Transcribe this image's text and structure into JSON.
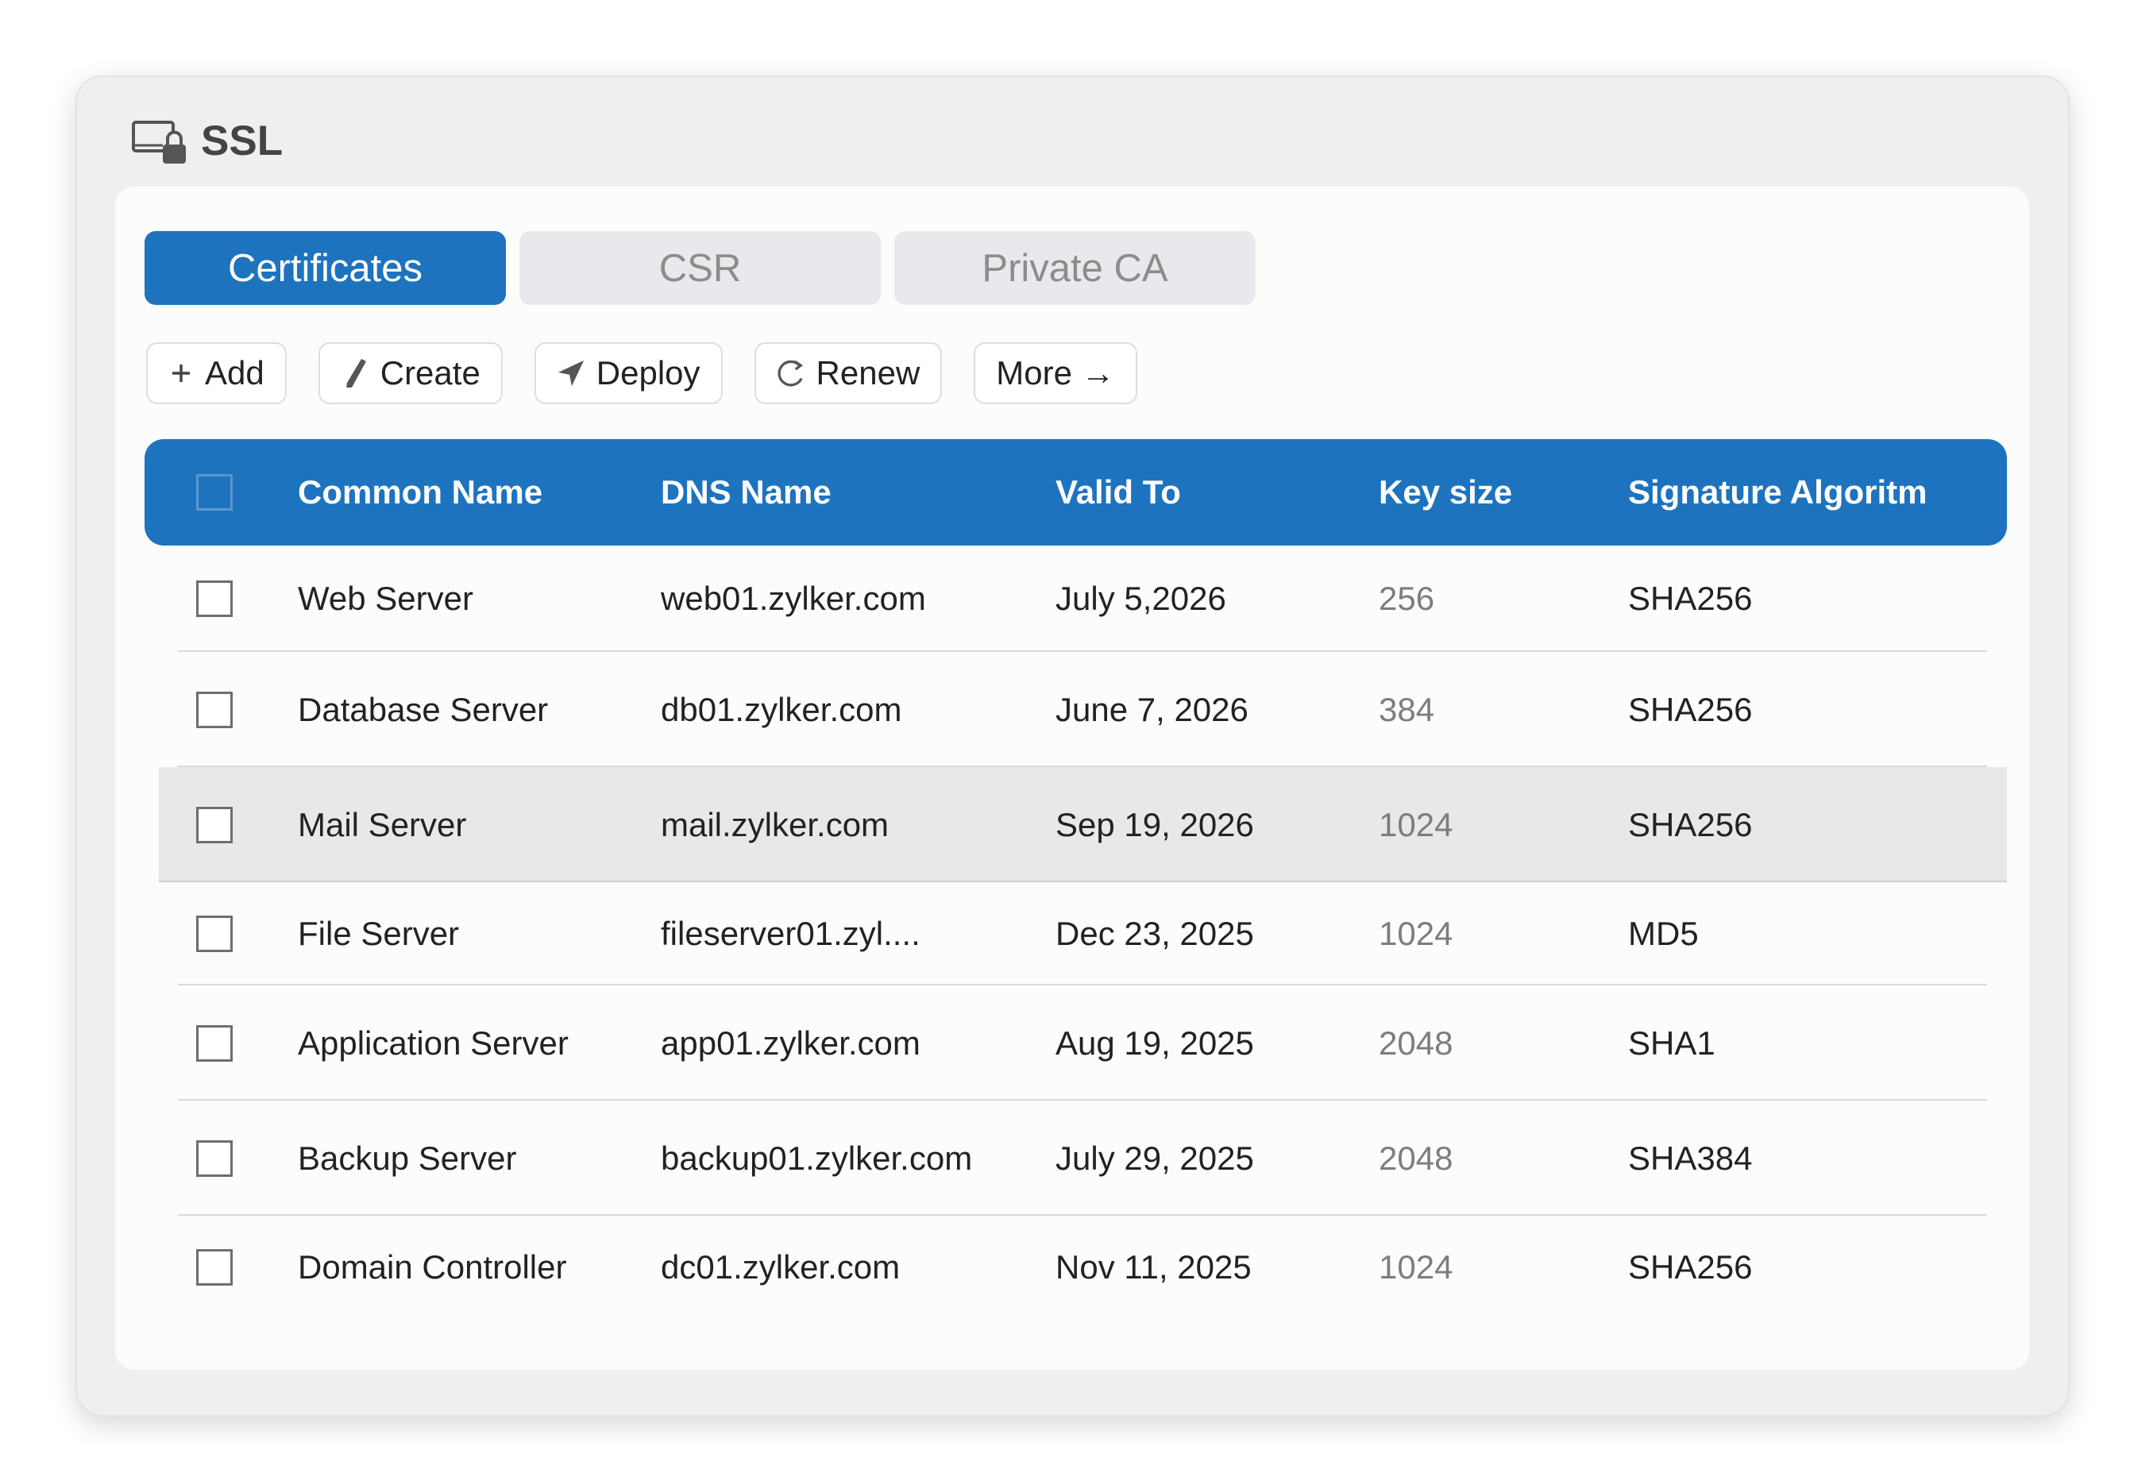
{
  "app": {
    "title": "SSL"
  },
  "tabs": [
    {
      "label": "Certificates",
      "active": true
    },
    {
      "label": "CSR",
      "active": false
    },
    {
      "label": "Private CA",
      "active": false
    }
  ],
  "toolbar": {
    "add": "Add",
    "create": "Create",
    "deploy": "Deploy",
    "renew": "Renew",
    "more": "More →"
  },
  "table": {
    "columns": [
      "Common Name",
      "DNS Name",
      "Valid To",
      "Key size",
      "Signature Algoritm"
    ],
    "rows": [
      {
        "common_name": "Web Server",
        "dns_name": "web01.zylker.com",
        "valid_to": "July 5,2026",
        "key_size": "256",
        "signature": "SHA256",
        "highlighted": false
      },
      {
        "common_name": "Database Server",
        "dns_name": "db01.zylker.com",
        "valid_to": "June 7, 2026",
        "key_size": "384",
        "signature": "SHA256",
        "highlighted": false
      },
      {
        "common_name": "Mail Server",
        "dns_name": "mail.zylker.com",
        "valid_to": "Sep 19, 2026",
        "key_size": "1024",
        "signature": "SHA256",
        "highlighted": true
      },
      {
        "common_name": "File Server",
        "dns_name": "fileserver01.zyl....",
        "valid_to": "Dec 23, 2025",
        "key_size": "1024",
        "signature": "MD5",
        "highlighted": false
      },
      {
        "common_name": "Application Server",
        "dns_name": "app01.zylker.com",
        "valid_to": "Aug 19, 2025",
        "key_size": "2048",
        "signature": "SHA1",
        "highlighted": false
      },
      {
        "common_name": "Backup Server",
        "dns_name": "backup01.zylker.com",
        "valid_to": "July 29, 2025",
        "key_size": "2048",
        "signature": "SHA384",
        "highlighted": false
      },
      {
        "common_name": "Domain Controller",
        "dns_name": "dc01.zylker.com",
        "valid_to": "Nov 11, 2025",
        "key_size": "1024",
        "signature": "SHA256",
        "highlighted": false
      }
    ]
  },
  "colors": {
    "accent": "#1e73be",
    "highlight_row": "#e8e8e8"
  },
  "icons": {
    "title": "monitor-lock-icon",
    "add": "plus-icon",
    "create": "pencil-icon",
    "deploy": "send-icon",
    "renew": "refresh-icon"
  }
}
